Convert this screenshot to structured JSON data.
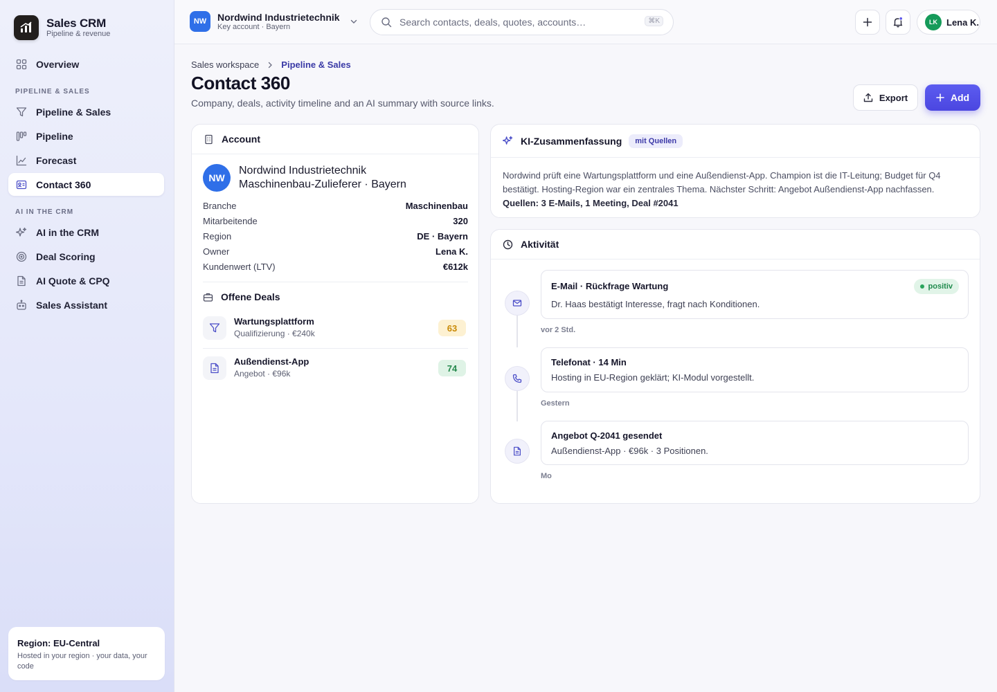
{
  "app": {
    "title": "Sales CRM",
    "subtitle": "Pipeline & revenue"
  },
  "sidebar": {
    "overview": "Overview",
    "section_pipeline": "PIPELINE & SALES",
    "pipeline_items": [
      {
        "label": "Pipeline & Sales",
        "icon": "filter-icon"
      },
      {
        "label": "Pipeline",
        "icon": "kanban-icon"
      },
      {
        "label": "Forecast",
        "icon": "trend-chart-icon"
      },
      {
        "label": "Contact 360",
        "icon": "contact-card-icon",
        "active": true
      }
    ],
    "section_ai": "AI IN THE CRM",
    "ai_items": [
      {
        "label": "AI in the CRM",
        "icon": "sparkle-icon"
      },
      {
        "label": "Deal Scoring",
        "icon": "target-icon"
      },
      {
        "label": "AI Quote & CPQ",
        "icon": "document-icon"
      },
      {
        "label": "Sales Assistant",
        "icon": "bot-icon"
      }
    ],
    "region_card": {
      "title": "Region: EU-Central",
      "description": "Hosted in your region · your data, your code"
    }
  },
  "topbar": {
    "account_initials": "NW",
    "account_name": "Nordwind Industrietechnik",
    "account_sub": "Key account · Bayern",
    "search_placeholder": "Search contacts, deals, quotes, accounts…",
    "search_shortcut": "⌘K",
    "user_initials": "LK",
    "user_name": "Lena K."
  },
  "page": {
    "breadcrumb": [
      "Sales workspace",
      "Pipeline & Sales"
    ],
    "title": "Contact 360",
    "subtitle": "Company, deals, activity timeline and an AI summary with source links.",
    "export_label": "Export",
    "add_label": "Add"
  },
  "account": {
    "header": "Account",
    "initials": "NW",
    "name": "Nordwind Industrietechnik",
    "descriptor": "Maschinenbau-Zulieferer · Bayern",
    "fields": [
      {
        "key": "Branche",
        "value": "Maschinenbau"
      },
      {
        "key": "Mitarbeitende",
        "value": "320"
      },
      {
        "key": "Region",
        "value": "DE · Bayern"
      },
      {
        "key": "Owner",
        "value": "Lena K."
      },
      {
        "key": "Kundenwert (LTV)",
        "value": "€612k"
      }
    ],
    "deals_header": "Offene Deals",
    "deals": [
      {
        "name": "Wartungsplattform",
        "sub": "Qualifizierung · €240k",
        "score": "63",
        "icon": "filter-icon",
        "score_color": "#c98a08"
      },
      {
        "name": "Außendienst-App",
        "sub": "Angebot · €96k",
        "score": "74",
        "icon": "document-icon",
        "score_color": "#25894d"
      }
    ]
  },
  "ai_summary": {
    "header": "KI-Zusammenfassung",
    "badge": "mit Quellen",
    "text": "Nordwind prüft eine Wartungsplattform und eine Außendienst-App. Champion ist die IT-Leitung; Budget für Q4 bestätigt. Hosting-Region war ein zentrales Thema. Nächster Schritt: Angebot Außendienst-App nachfassen.",
    "sources": "Quellen: 3 E-Mails, 1 Meeting, Deal #2041"
  },
  "activity": {
    "header": "Aktivität",
    "items": [
      {
        "title": "E-Mail · Rückfrage Wartung",
        "desc": "Dr. Haas bestätigt Interesse, fragt nach Konditionen.",
        "time": "vor 2 Std.",
        "badge": "positiv",
        "icon": "mail-icon"
      },
      {
        "title": "Telefonat · 14 Min",
        "desc": "Hosting in EU-Region geklärt; KI-Modul vorgestellt.",
        "time": "Gestern",
        "icon": "phone-icon"
      },
      {
        "title": "Angebot Q-2041 gesendet",
        "desc": "Außendienst-App · €96k · 3 Positionen.",
        "time": "Mo",
        "icon": "document-icon"
      }
    ]
  },
  "colors": {
    "accent": "#4b46e0",
    "brand_blue": "#2f6fe8",
    "positive": "#1f8a4c",
    "amber": "#c98a08"
  }
}
